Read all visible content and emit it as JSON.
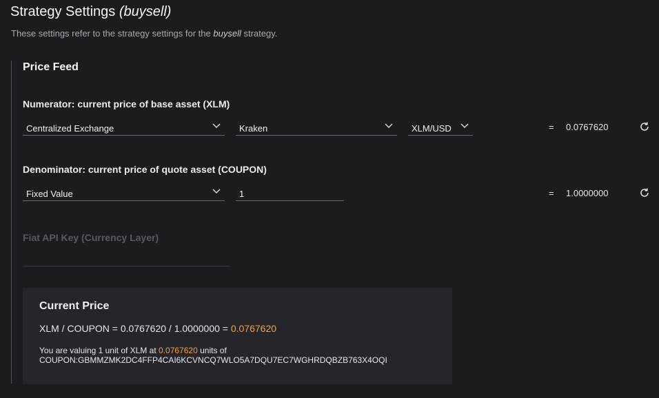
{
  "header": {
    "title": "Strategy Settings",
    "title_strategy": "(buysell)",
    "subtitle_prefix": "These settings refer to the strategy settings for the",
    "subtitle_strategy": "buysell",
    "subtitle_suffix": "strategy."
  },
  "price_feed": {
    "title": "Price Feed",
    "numerator": {
      "label": "Numerator: current price of base asset (XLM)",
      "type_select": "Centralized Exchange",
      "exchange_select": "Kraken",
      "pair_select": "XLM/USD",
      "equals": "=",
      "value": "0.0767620"
    },
    "denominator": {
      "label": "Denominator: current price of quote asset (COUPON)",
      "type_select": "Fixed Value",
      "fixed_value": "1",
      "equals": "=",
      "value": "1.0000000"
    },
    "fiat_api_key_label": "Fiat API Key (Currency Layer)"
  },
  "current_price": {
    "title": "Current Price",
    "formula_prefix": "XLM / COUPON = 0.0767620 / 1.0000000 =",
    "result": "0.0767620",
    "desc_prefix": "You are valuing 1 unit of XLM at",
    "desc_value": "0.0767620",
    "desc_suffix": "units of",
    "desc_asset": "COUPON:GBMMZMK2DC4FFP4CAI6KCVNCQ7WLO5A7DQU7EC7WGHRDQBZB763X4OQI"
  },
  "colors": {
    "background": "#1c1b20",
    "panel": "#26252b",
    "accent": "#f5a03a"
  }
}
